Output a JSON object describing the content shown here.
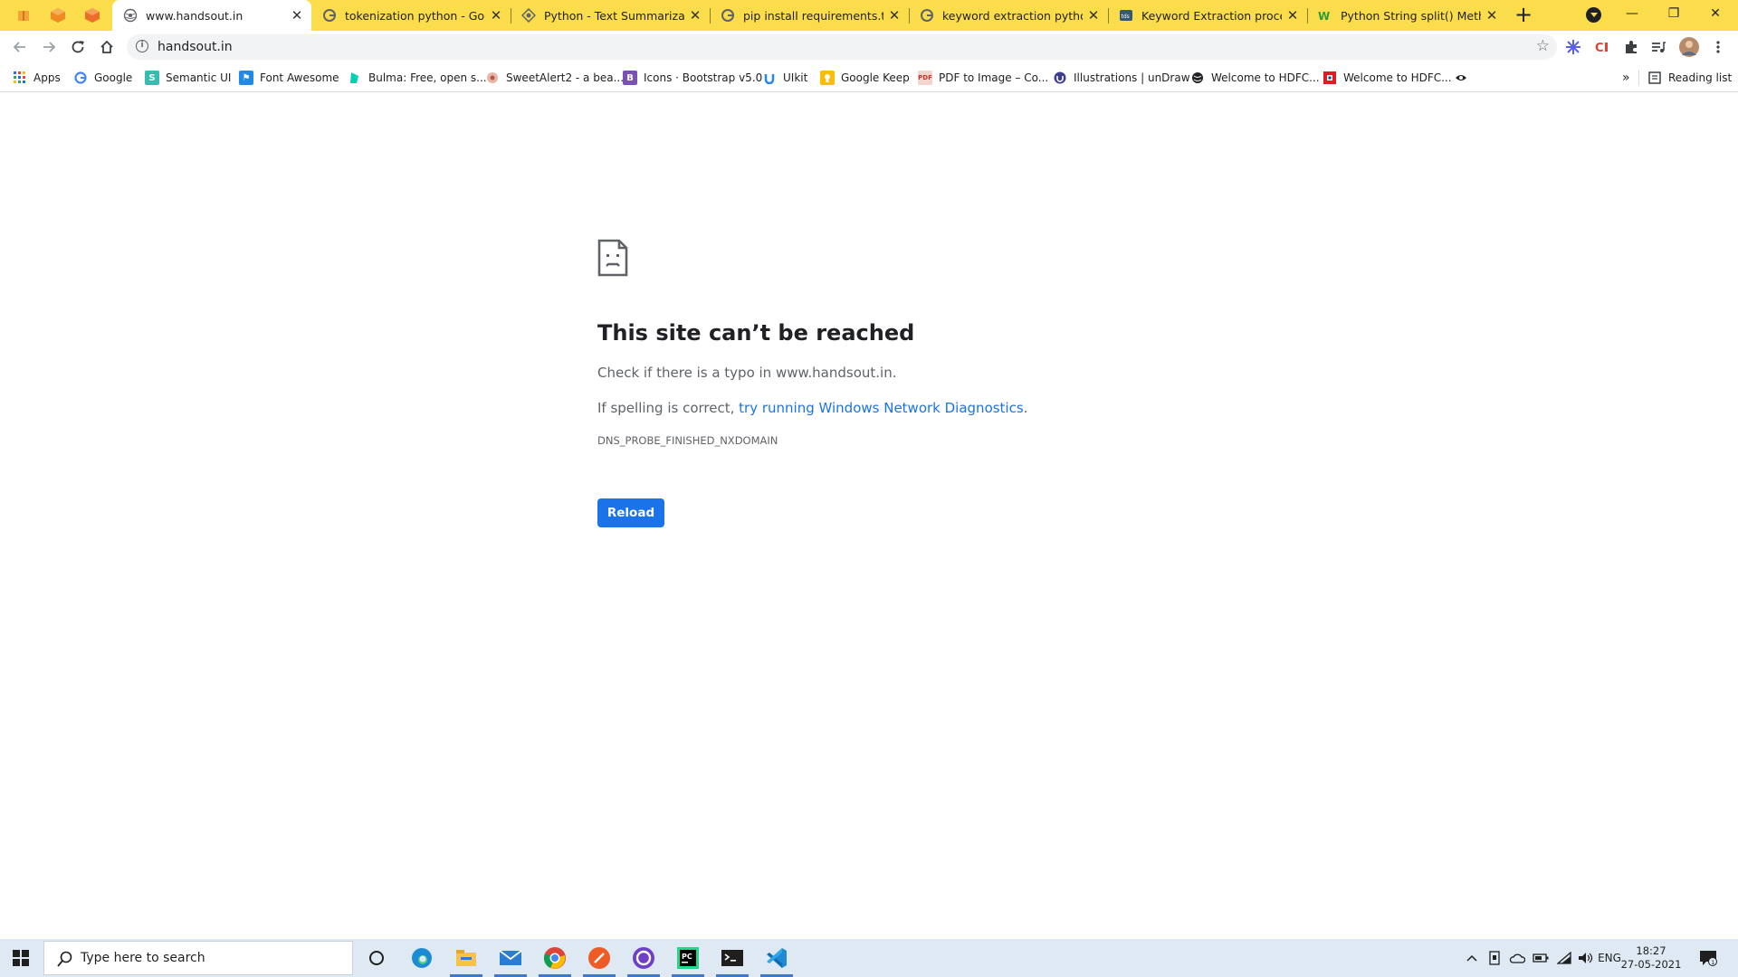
{
  "tabs": [
    {
      "title": "www.handsout.in",
      "favicon": "globe-icon",
      "active": true
    },
    {
      "title": "tokenization python - Google",
      "favicon": "google-icon",
      "active": false
    },
    {
      "title": "Python - Text Summarization",
      "favicon": "diamond-icon",
      "active": false
    },
    {
      "title": "pip install requirements.txt - ",
      "favicon": "google-icon",
      "active": false
    },
    {
      "title": "keyword extraction python nl",
      "favicon": "google-icon",
      "active": false
    },
    {
      "title": "Keyword Extraction process i",
      "favicon": "tds-icon",
      "active": false
    },
    {
      "title": "Python String split() Method",
      "favicon": "w3-icon",
      "active": false
    }
  ],
  "tab_close_glyph": "✕",
  "new_tab_glyph": "+",
  "window_controls": {
    "minimize": "—",
    "restore": "❐",
    "close": "✕"
  },
  "toolbar": {
    "url": "handsout.in",
    "info_glyph": "i",
    "star_glyph": "☆"
  },
  "bookmarks": [
    {
      "label": "Apps",
      "icon": "apps-grid-icon"
    },
    {
      "label": "Google",
      "icon": "google-icon"
    },
    {
      "label": "Semantic UI",
      "icon": "semantic-ui-icon"
    },
    {
      "label": "Font Awesome",
      "icon": "font-awesome-icon"
    },
    {
      "label": "Bulma: Free, open s...",
      "icon": "bulma-icon"
    },
    {
      "label": "SweetAlert2 - a bea...",
      "icon": "sweetalert-icon"
    },
    {
      "label": "Icons · Bootstrap v5.0",
      "icon": "bootstrap-icon"
    },
    {
      "label": "UIkit",
      "icon": "uikit-icon"
    },
    {
      "label": "Google Keep",
      "icon": "google-keep-icon"
    },
    {
      "label": "PDF to Image – Co...",
      "icon": "pdf-icon"
    },
    {
      "label": "Illustrations | unDraw",
      "icon": "undraw-icon"
    },
    {
      "label": "Welcome to HDFC...",
      "icon": "globe-icon"
    },
    {
      "label": "Welcome to HDFC...",
      "icon": "hdfc-icon"
    }
  ],
  "bookmarks_overflow": "»",
  "reading_list": "Reading list",
  "error": {
    "heading": "This site can’t be reached",
    "check_line": "Check if there is a typo in www.handsout.in.",
    "spelling_prefix": "If spelling is correct, ",
    "diagnostics_link": "try running Windows Network Diagnostics",
    "spelling_suffix": ".",
    "code": "DNS_PROBE_FINISHED_NXDOMAIN",
    "reload_button": "Reload"
  },
  "taskbar": {
    "search_placeholder": "Type here to search",
    "apps": [
      "cortana-icon",
      "edge-icon",
      "file-explorer-icon",
      "mail-icon",
      "chrome-icon",
      "postman-icon",
      "github-desktop-icon",
      "pycharm-icon",
      "terminal-icon",
      "vscode-icon"
    ],
    "language": "ENG",
    "time": "18:27",
    "date": "27-05-2021",
    "notification_count": "1"
  },
  "colors": {
    "tabstrip": "#fbdd4c",
    "link": "#1a73e8",
    "button": "#1a73e8",
    "taskbar": "#dfe9f3"
  }
}
